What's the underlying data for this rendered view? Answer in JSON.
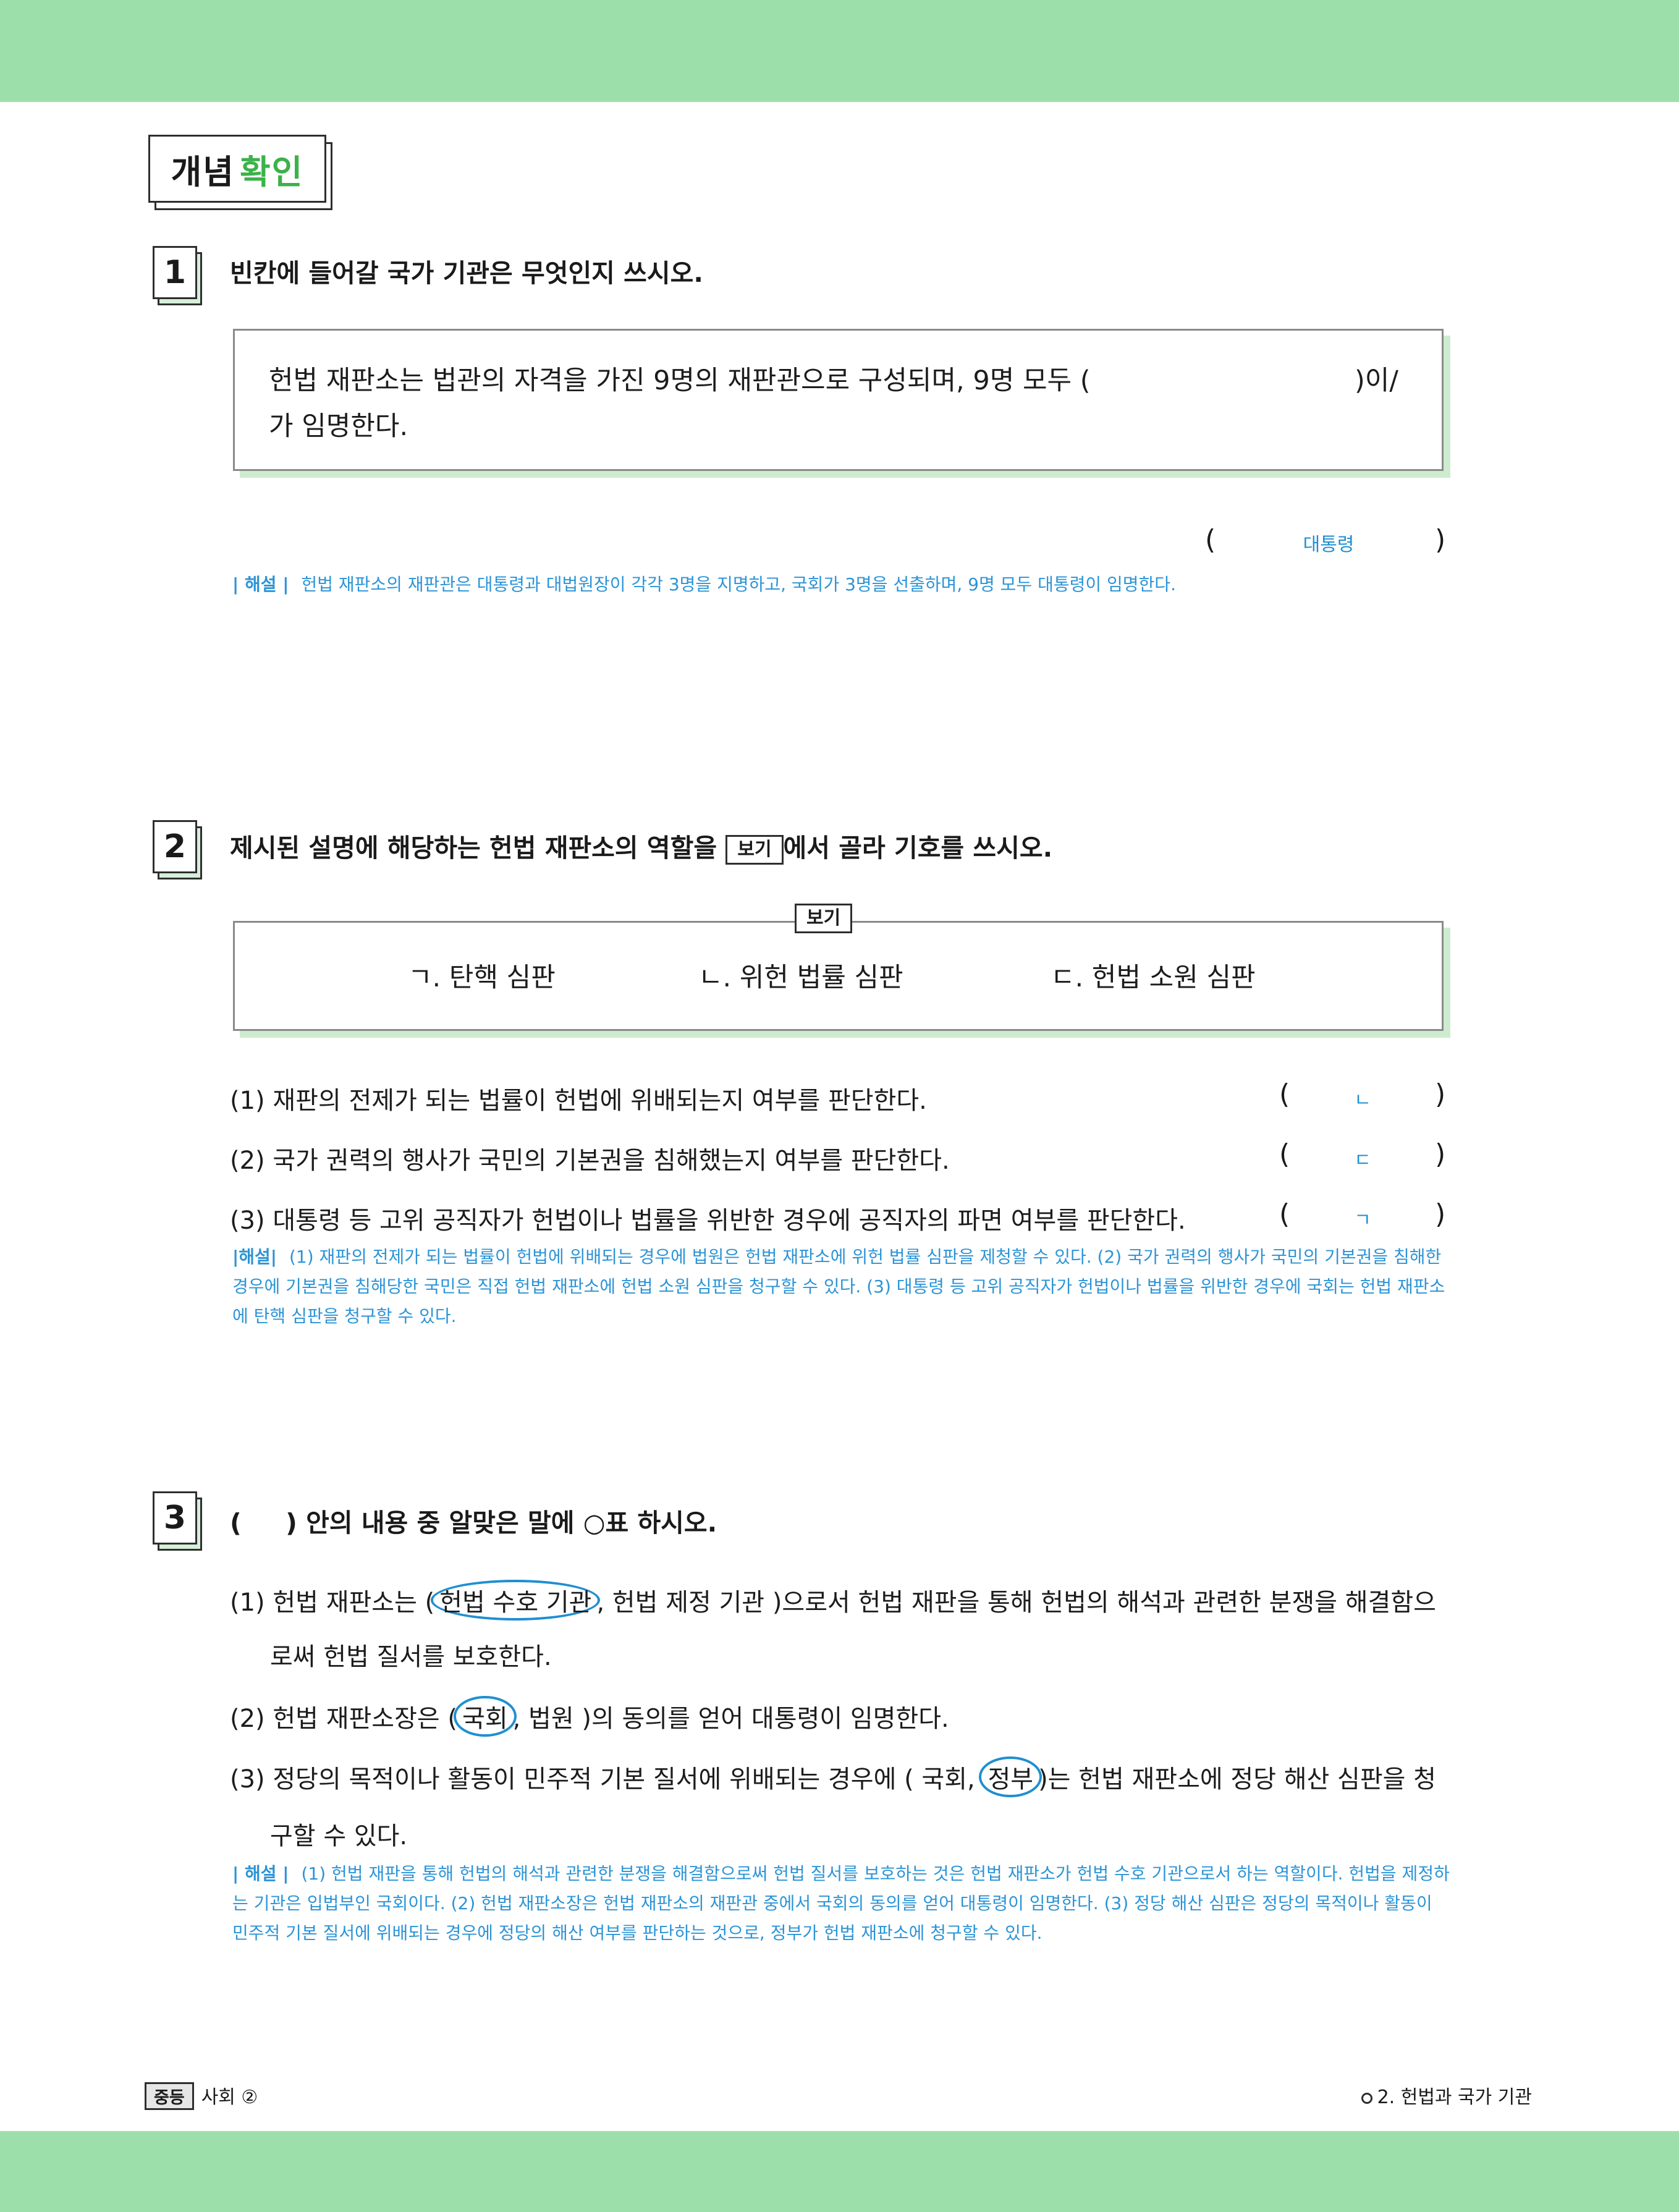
{
  "header": {
    "title_main": "개념",
    "title_accent": "확인"
  },
  "q1": {
    "number": "1",
    "prompt": "빈칸에 들어갈 국가 기관은 무엇인지 쓰시오.",
    "box_line1": "헌법 재판소는 법관의 자격을 가진 9명의 재판관으로 구성되며, 9명 모두 (",
    "box_line1_end": ")이/",
    "box_line2": "가 임명한다.",
    "answer": "대통령",
    "explain_label": "| 해설 |",
    "explain": "헌법 재판소의 재판관은 대통령과 대법원장이 각각 3명을 지명하고, 국회가 3명을 선출하며, 9명 모두 대통령이 임명한다."
  },
  "q2": {
    "number": "2",
    "prompt_before": "제시된 설명에 해당하는 헌법 재판소의 역할을",
    "bogi": "보기",
    "prompt_after": "에서 골라 기호를 쓰시오.",
    "options": [
      "ㄱ. 탄핵 심판",
      "ㄴ. 위헌 법률 심판",
      "ㄷ. 헌법 소원 심판"
    ],
    "items": [
      {
        "text": "(1) 재판의 전제가 되는 법률이 헌법에 위배되는지 여부를 판단한다.",
        "answer": "ㄴ"
      },
      {
        "text": "(2) 국가 권력의 행사가 국민의 기본권을 침해했는지 여부를 판단한다.",
        "answer": "ㄷ"
      },
      {
        "text": "(3) 대통령 등 고위 공직자가 헌법이나 법률을 위반한 경우에 공직자의 파면 여부를 판단한다.",
        "answer": "ㄱ"
      }
    ],
    "explain_label": "|해설|",
    "explain": "(1) 재판의 전제가 되는 법률이 헌법에 위배되는 경우에 법원은 헌법 재판소에 위헌 법률 심판을 제청할 수 있다. (2) 국가 권력의 행사가 국민의 기본권을 침해한 경우에 기본권을 침해당한 국민은 직접 헌법 재판소에 헌법 소원 심판을 청구할 수 있다. (3) 대통령 등 고위 공직자가 헌법이나 법률을 위반한 경우에 국회는 헌법 재판소에 탄핵 심판을 청구할 수 있다."
  },
  "q3": {
    "number": "3",
    "prompt": "(     ) 안의 내용 중 알맞은 말에 ○표 하시오.",
    "item1_a": "(1) 헌법 재판소는 (",
    "item1_circled": "헌법 수호 기관",
    "item1_b": ", 헌법 제정 기관 )으로서 헌법 재판을 통해 헌법의 해석과 관련한 분쟁을 해결함으",
    "item1_line2": "로써 헌법 질서를 보호한다.",
    "item2_a": "(2) 헌법 재판소장은 (",
    "item2_circled": "국회",
    "item2_b": ", 법원 )의 동의를 얻어 대통령이 임명한다.",
    "item3_a": "(3) 정당의 목적이나 활동이 민주적 기본 질서에 위배되는 경우에 ( 국회,",
    "item3_circled": "정부",
    "item3_b": ")는 헌법 재판소에 정당 해산 심판을 청",
    "item3_line2": "구할 수 있다.",
    "explain_label": "| 해설 |",
    "explain": "(1) 헌법 재판을 통해 헌법의 해석과 관련한 분쟁을 해결함으로써 헌법 질서를 보호하는 것은 헌법 재판소가 헌법 수호 기관으로서 하는 역할이다. 헌법을 제정하는 기관은 입법부인 국회이다. (2) 헌법 재판소장은 헌법 재판소의 재판관 중에서 국회의 동의를 얻어 대통령이 임명한다. (3) 정당 해산 심판은 정당의 목적이나 활동이 민주적 기본 질서에 위배되는 경우에 정당의 해산 여부를 판단하는 것으로, 정부가 헌법 재판소에 청구할 수 있다."
  },
  "footer": {
    "tag": "중등",
    "subject": "사회 ②",
    "chapter": "2. 헌법과 국가 기관"
  },
  "colors": {
    "band": "#9ddfaa",
    "accent_green": "#3bb24a",
    "answer_blue": "#1f8fd1"
  }
}
